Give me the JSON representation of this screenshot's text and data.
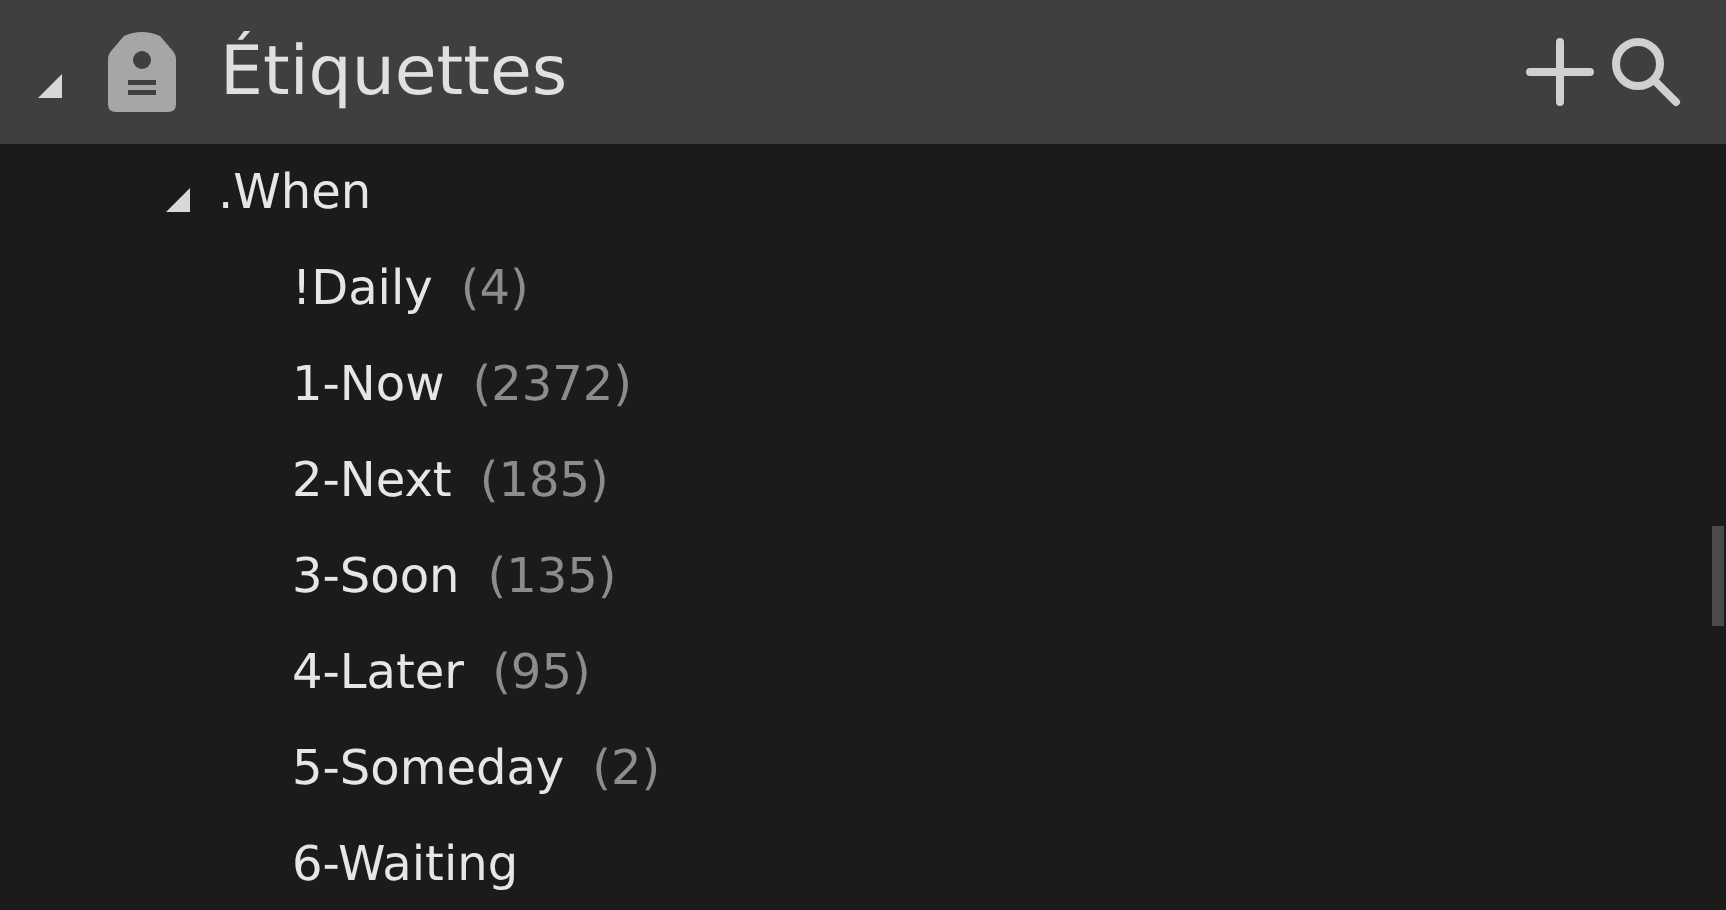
{
  "panel": {
    "title": "Étiquettes",
    "expanded": true
  },
  "tree": [
    {
      "label": ".When",
      "expanded": true,
      "children": [
        {
          "label": "!Daily",
          "count": "(4)"
        },
        {
          "label": "1-Now",
          "count": "(2372)"
        },
        {
          "label": "2-Next",
          "count": "(185)"
        },
        {
          "label": "3-Soon",
          "count": "(135)"
        },
        {
          "label": "4-Later",
          "count": "(95)"
        },
        {
          "label": "5-Someday",
          "count": "(2)"
        },
        {
          "label": "6-Waiting"
        }
      ]
    }
  ]
}
